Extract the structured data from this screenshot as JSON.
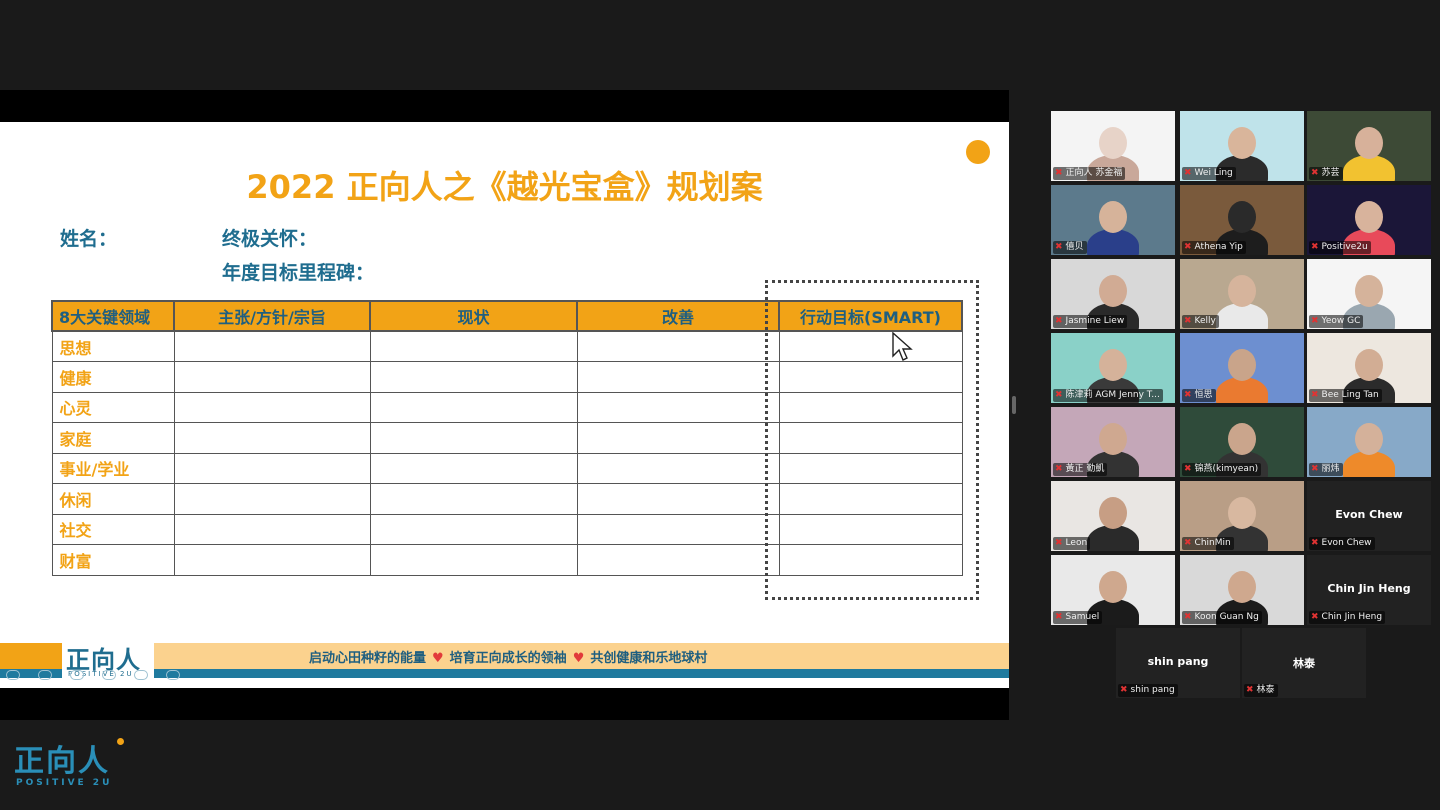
{
  "slide": {
    "title": "2022 正向人之《越光宝盒》规划案",
    "name_label": "姓名：",
    "concern_label": "终极关怀：",
    "milestone_label": "年度目标里程碑：",
    "table": {
      "headers": [
        "8大关键领域",
        "主张/方针/宗旨",
        "现状",
        "改善",
        "行动目标(SMART)"
      ],
      "rows": [
        "思想",
        "健康",
        "心灵",
        "家庭",
        "事业/学业",
        "休闲",
        "社交",
        "财富"
      ]
    },
    "banner": {
      "part1": "启动心田种籽的能量",
      "part2": "培育正向成长的领袖",
      "part3": "共创健康和乐地球村",
      "heart": "♥"
    },
    "logo_text": "正向人",
    "logo_sub": "POSITIVE 2U",
    "accent_color": "#f2a316",
    "primary_color": "#1f6d8f"
  },
  "brand": {
    "logo_text": "正向人",
    "logo_sub": "POSITIVE 2U"
  },
  "gallery": {
    "mic_icon": "mic-muted-icon",
    "participants": [
      {
        "name": "正向人 苏金福",
        "video": true
      },
      {
        "name": "Wei Ling",
        "video": true
      },
      {
        "name": "苏芸",
        "video": true
      },
      {
        "name": "僖贝",
        "video": true
      },
      {
        "name": "Athena Yip",
        "video": true
      },
      {
        "name": "Positive2u",
        "video": true
      },
      {
        "name": "Jasmine Liew",
        "video": true
      },
      {
        "name": "Kelly",
        "video": true
      },
      {
        "name": "Yeow GC",
        "video": true
      },
      {
        "name": "陈津莉 AGM Jenny T...",
        "video": true
      },
      {
        "name": "恒思",
        "video": true
      },
      {
        "name": "Bee Ling Tan",
        "video": true
      },
      {
        "name": "黃正 勤凱",
        "video": true
      },
      {
        "name": "锦燕(kimyean)",
        "video": true
      },
      {
        "name": "丽炜",
        "video": true
      },
      {
        "name": "Leon",
        "video": true
      },
      {
        "name": "ChinMin",
        "video": true
      },
      {
        "name": "Evon Chew",
        "video": false
      },
      {
        "name": "Samuel",
        "video": true
      },
      {
        "name": "Koon Guan Ng",
        "video": true
      },
      {
        "name": "Chin Jin Heng",
        "video": false
      },
      {
        "name": "shin pang",
        "video": false
      },
      {
        "name": "林泰",
        "video": false
      }
    ]
  }
}
